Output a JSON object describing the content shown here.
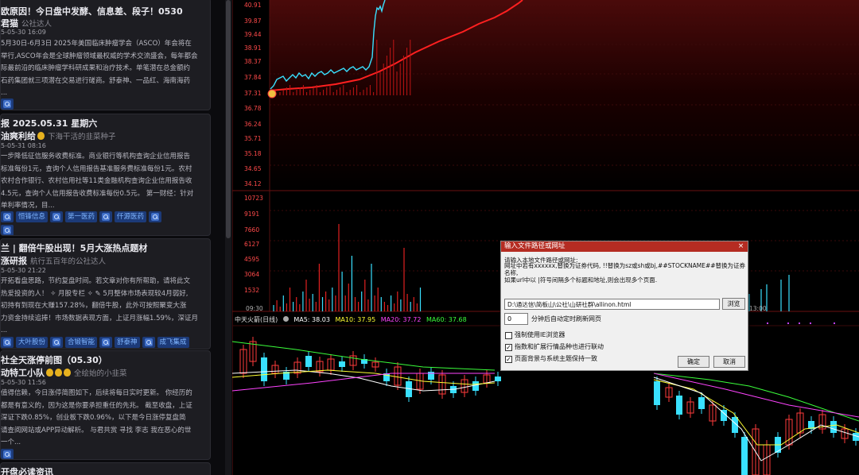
{
  "news": [
    {
      "title": "欧原因！今日盘中发酵、信息差、段子！0530",
      "author": "君猫",
      "author_src": "公社达人",
      "medals": 0,
      "date": "5-05-30 16:09",
      "body": [
        "5月30日-6月3日 2025年美国临床肿瘤学会（ASCO）年会将在",
        "举行,ASCO年会是全球肿瘤领域最权威的学术交流盛会，每年都会",
        "际最前沿的临床肿瘤学科研成果和治疗技术。单笔潜在总金额约",
        "石药集团就三项潜在交易进行磋商。舒泰神、一品红、海南海药",
        "..."
      ],
      "tags": []
    },
    {
      "title": "报 2025.05.31 星期六",
      "author": "油爽利给",
      "author_src": "下海干活的韭菜种子",
      "medals": 1,
      "date": "5-05-31 08:16",
      "body": [
        "一步降低征信服务收费标准。商业银行等机构查询企业信用报告",
        "标准每份1元，查询个人信用报告基准服务费标准每份1元。农村",
        "农村合作银行、农村信用社等11类金融机构查询企业信用报告收",
        "4.5元，查询个人信用报告收费标准每份0.5元。 第一财经：针对",
        "单利率情况，目..."
      ],
      "tags": [
        "恒锋信息",
        "第一医药",
        "仟源医药",
        ""
      ]
    },
    {
      "title": "兰 | 翻倍牛股出现！5月大涨热点题材",
      "author": "涨研报",
      "author_src": "航行五百年的公社达人",
      "medals": 0,
      "date": "5-05-30 21:22",
      "body": [
        "开拓看盘思路，节约复盘时间。若文章对你有所帮助，请将此文",
        "热爱投资的人！ ✧ 月股专栏 ✧ ✎ 5月整体市场表现较4月弱好,",
        "初持有到现在大赚157.28%，翻倍牛股，此外可按照聚变大涨",
        "力资金持续追捧！市场数据表现方面，上证月涨幅1.59%，深证月",
        "..."
      ],
      "tags": [
        "大叶股份",
        "合锻智能",
        "舒泰神",
        "成飞集成"
      ]
    },
    {
      "title": "社全天涨停前图（05.30）",
      "author": "动特工小队",
      "author_src": "全绘始的小韭菜",
      "medals": 3,
      "date": "5-05-30 11:56",
      "body": [
        "值得信赖，今日涨停简图如下，后续将每日实时更新。 你经历的",
        "都是有意义的，因为这是你要承担重任的先兆。 截至收盘，上证",
        "深证下跌0.85%，创业板下跌0.96%，以下是今日涨停复盘简",
        "请查阅网站或APP异动解析。 与君共赏 寻找 李志 我在恶心的世",
        "一个..."
      ],
      "tags": [
        ""
      ]
    },
    {
      "title": "开盘必读资讯",
      "author": "",
      "author_src": "",
      "medals": 0,
      "date": "",
      "body": [],
      "tags": []
    }
  ],
  "price_axis": [
    "40.91",
    "39.87",
    "39.44",
    "38.91",
    "38.37",
    "37.84",
    "37.31",
    "36.78",
    "36.24",
    "35.71",
    "35.18",
    "34.65",
    "34.12"
  ],
  "volume_axis": [
    "10723",
    "9191",
    "7660",
    "6127",
    "4595",
    "3064",
    "1532"
  ],
  "time_axis": [
    "09:30",
    "13:00"
  ],
  "indicator_bar": {
    "name": "中天火箭(日线)",
    "ma5": "MA5: 38.03",
    "ma10": "MA10: 37.95",
    "ma20": "MA20: 37.72",
    "ma60": "MA60: 37.68"
  },
  "colors": {
    "up": "#ff3b3b",
    "down": "#39e0ff",
    "ma5": "#ffffff",
    "ma10": "#ffff33",
    "ma20": "#ff44ff",
    "ma60": "#3bff3b",
    "dialog_title_bg": "#b52c22"
  },
  "dialog": {
    "title": "输入文件路径或网址",
    "close": "×",
    "desc": [
      "请输入本地文件路径或网址:",
      "网址中若有xxxxxx,替换为证券代码, !!替换为sz或sh或bj,##STOCKNAME##替换为证券名称,",
      "如果url中以 |符号间隔多个标题和地址,则会出现多个页面."
    ],
    "path_value": "D:\\通达信\\简板山\\公社\\山研社群\\allinon.html",
    "browse": "浏览",
    "minutes_value": "0",
    "minutes_label": "分钟后自动定时刷新网页",
    "options": [
      {
        "label": "强制使用IE浏览器",
        "checked": false
      },
      {
        "label": "指数和扩展行情品种也进行联动",
        "checked": true
      },
      {
        "label": "页面背景与系统主题保持一致",
        "checked": true
      }
    ],
    "ok": "确定",
    "cancel": "取消"
  }
}
